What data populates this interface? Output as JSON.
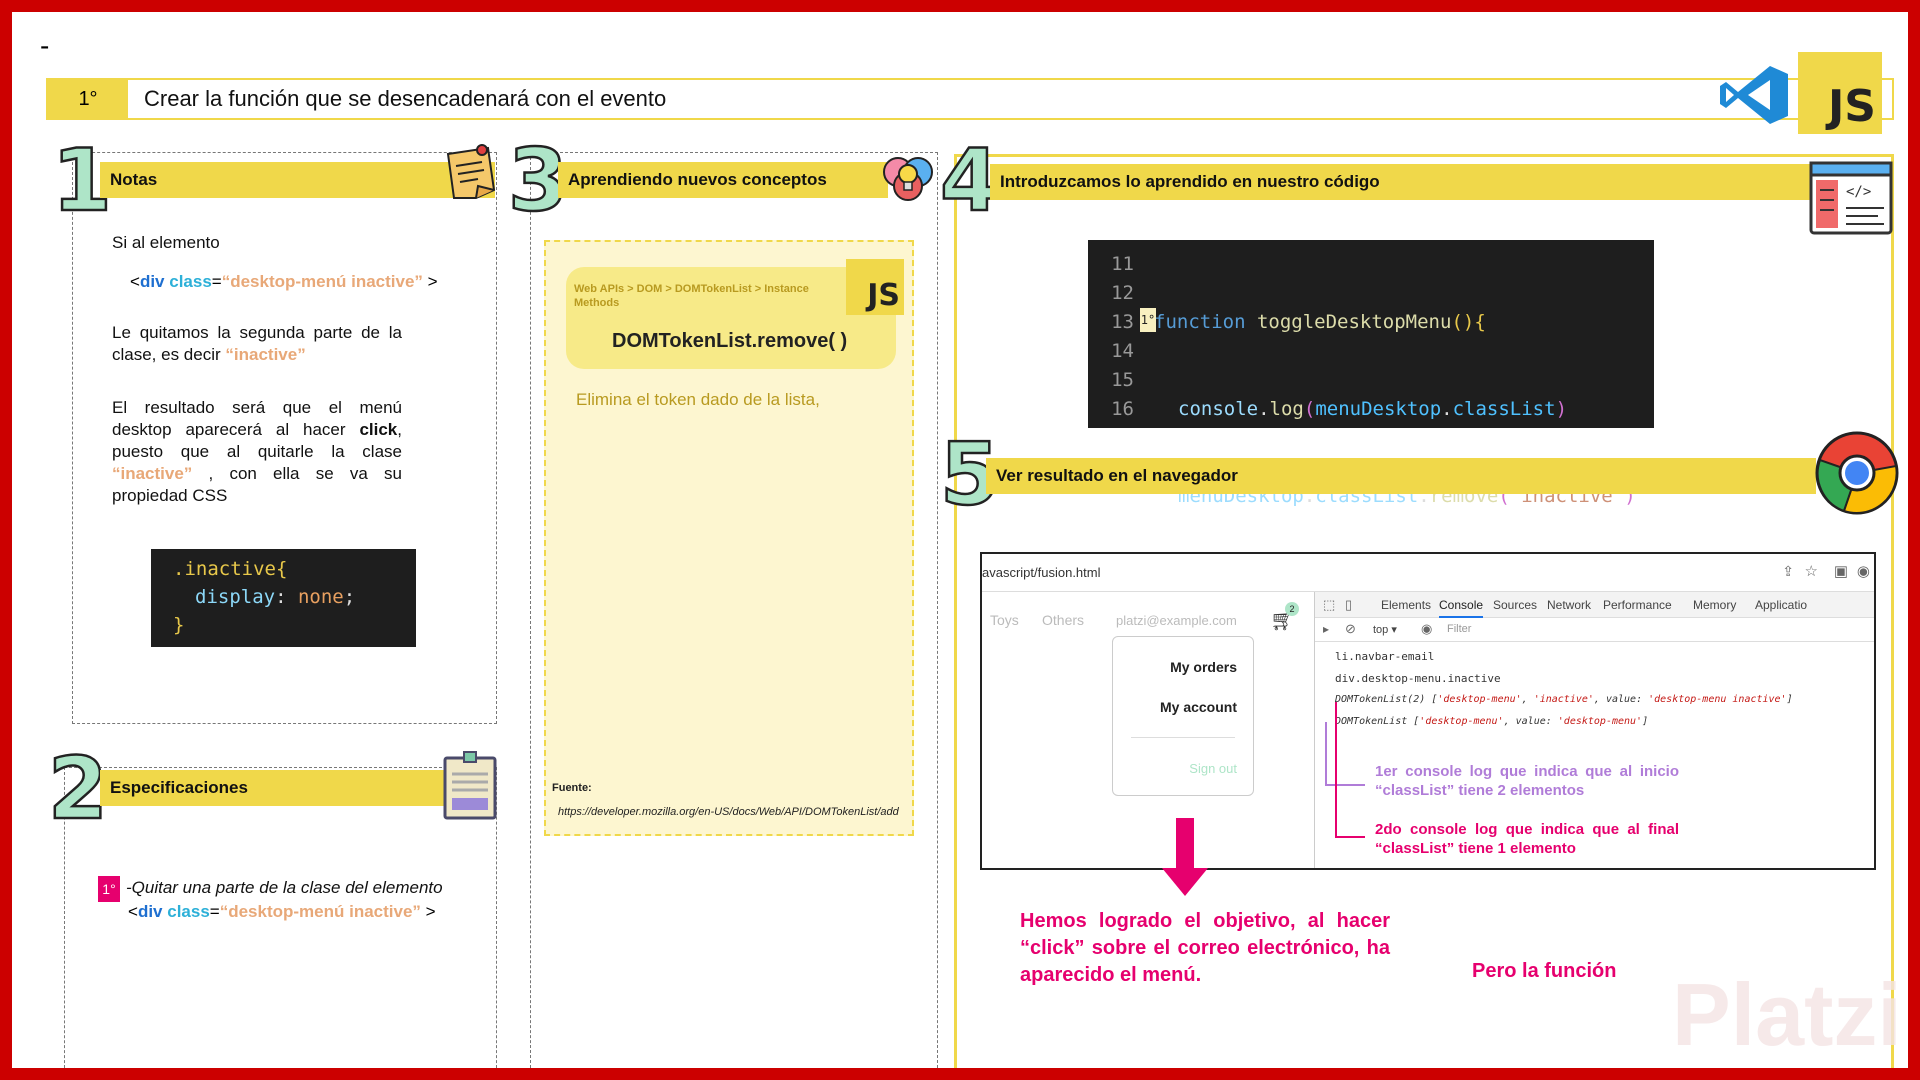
{
  "header": {
    "dash": "-",
    "step_number": "1°",
    "title": "Crear la función que se desencadenará con el evento",
    "js_badge": "JS",
    "vscode_icon": "vscode-icon"
  },
  "section1": {
    "number": "1",
    "title": "Notas",
    "p1": "Si al elemento",
    "code_lt": "<",
    "code_div": "div",
    "code_class": "class",
    "code_eq": "=",
    "code_value": "“desktop-menú inactive”",
    "code_gt": " >",
    "p2_a": "Le quitamos la segunda parte de la clase, es decir ",
    "p2_b": "“inactive”",
    "p3_a": "El resultado será que el menú desktop aparecerá al hacer ",
    "p3_b": "click",
    "p3_c": ", puesto que al quitarle la clase ",
    "p3_d": "“inactive”",
    "p3_e": " , con ella se va su propiedad CSS",
    "css_line1": ".inactive{",
    "css_prop": "display",
    "css_colon": ": ",
    "css_val": "none",
    "css_semi": ";",
    "css_close": "}"
  },
  "section2": {
    "number": "2",
    "title": "Especificaciones",
    "badge": "1°",
    "spec": "-Quitar una parte de la clase del elemento",
    "code_lt": "<",
    "code_div": "div",
    "code_class": "class",
    "code_eq": "=",
    "code_value": "“desktop-menú inactive”",
    "code_gt": " >"
  },
  "section3": {
    "number": "3",
    "title": "Aprendiendo nuevos conceptos",
    "breadcrumb": "Web APIs > DOM > DOMTokenList > Instance Methods",
    "js_badge": "JS",
    "method": "DOMTokenList.remove( )",
    "description": "Elimina el token dado de la lista,",
    "source_label": "Fuente:",
    "source_url": "https://developer.mozilla.org/en-US/docs/Web/API/DOMTokenList/add"
  },
  "section4": {
    "number": "4",
    "title": "Introduzcamos lo aprendido en nuestro código",
    "lines": [
      {
        "n": "11"
      },
      {
        "n": "12"
      },
      {
        "n": "13",
        "marker": "1°"
      },
      {
        "n": "14"
      },
      {
        "n": "15"
      },
      {
        "n": "16"
      }
    ],
    "kw_function": "function",
    "fn_name": "toggleDesktopMenu",
    "paren_open": "(){",
    "console": "console",
    "dot": ".",
    "log": "log",
    "lp": "(",
    "menuDesktop": "menuDesktop",
    "classList": "classList",
    "rp": ")",
    "remove": "remove",
    "inactive_str": "\"inactive\"",
    "brace_close": "}"
  },
  "section5": {
    "number": "5",
    "title": "Ver resultado en el navegador",
    "url": "avascript/fusion.html",
    "nav": [
      "Toys",
      "Others"
    ],
    "email": "platzi@example.com",
    "cart_count": "2",
    "menu": [
      "My orders",
      "My account",
      "Sign out"
    ],
    "devtools_tabs": [
      "Elements",
      "Console",
      "Sources",
      "Network",
      "Performance",
      "Memory",
      "Applicatio"
    ],
    "toolbar_top": "top ▾",
    "filter": "Filter",
    "console_lines": [
      "li.navbar-email",
      "div.desktop-menu.inactive"
    ],
    "tokenlist1_a": "DOMTokenList(2) [",
    "tokenlist1_b": "'desktop-menu'",
    "tokenlist1_c": ", ",
    "tokenlist1_d": "'inactive'",
    "tokenlist1_e": ", value: ",
    "tokenlist1_f": "'desktop-menu inactive'",
    "tokenlist1_g": "]",
    "tokenlist2_a": "DOMTokenList [",
    "tokenlist2_b": "'desktop-menu'",
    "tokenlist2_c": ", value: ",
    "tokenlist2_d": "'desktop-menu'",
    "tokenlist2_e": "]",
    "note1": "1er console log que indica que al inicio “classList” tiene 2 elementos",
    "note2": "2do console log que indica que al final “classList” tiene 1 elemento",
    "result": "Hemos logrado el objetivo, al hacer “click” sobre el correo electrónico, ha aparecido el menú.",
    "but": "Pero la función",
    "watermark": "Platzi"
  }
}
